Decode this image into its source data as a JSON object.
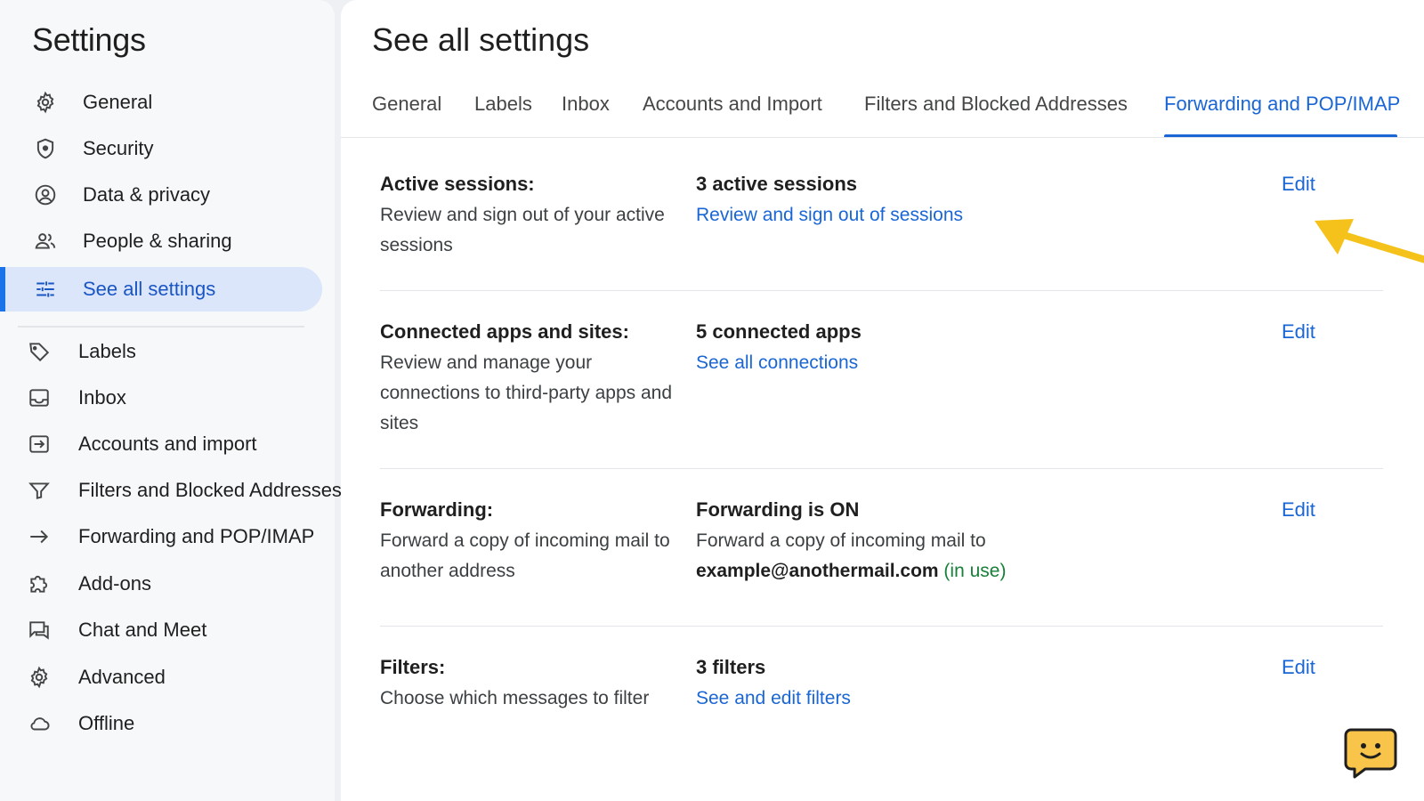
{
  "sidebar": {
    "title": "Settings",
    "items_top": [
      {
        "label": "General",
        "icon": "gear-icon"
      },
      {
        "label": "Security",
        "icon": "shield-icon"
      },
      {
        "label": "Data & privacy",
        "icon": "account-circle-icon"
      },
      {
        "label": "People & sharing",
        "icon": "people-icon"
      },
      {
        "label": "See all settings",
        "icon": "tune-icon",
        "active": true
      }
    ],
    "items_bottom": [
      {
        "label": "Labels",
        "icon": "label-icon"
      },
      {
        "label": "Inbox",
        "icon": "inbox-icon"
      },
      {
        "label": "Accounts and import",
        "icon": "import-icon"
      },
      {
        "label": "Filters and Blocked Addresses",
        "icon": "filter-icon"
      },
      {
        "label": "Forwarding and POP/IMAP",
        "icon": "arrow-right-icon"
      },
      {
        "label": "Add-ons",
        "icon": "puzzle-icon"
      },
      {
        "label": "Chat and Meet",
        "icon": "chat-icon"
      },
      {
        "label": "Advanced",
        "icon": "gear-icon"
      },
      {
        "label": "Offline",
        "icon": "cloud-icon"
      }
    ]
  },
  "main": {
    "title": "See all settings",
    "tabs": [
      {
        "label": "General"
      },
      {
        "label": "Labels"
      },
      {
        "label": "Inbox"
      },
      {
        "label": "Accounts and Import"
      },
      {
        "label": "Filters and Blocked Addresses"
      },
      {
        "label": "Forwarding and POP/IMAP",
        "active": true
      }
    ],
    "rows": [
      {
        "label": "Active sessions:",
        "description": "Review and sign out of your active sessions",
        "status": "3 active sessions",
        "link": "Review and sign out of sessions",
        "edit": "Edit"
      },
      {
        "label": "Connected apps and sites:",
        "description": "Review and manage your connections to third-party apps and sites",
        "status": "5 connected apps",
        "link": "See all connections",
        "edit": "Edit"
      },
      {
        "label": "Forwarding:",
        "description": "Forward a copy of incoming mail to another address",
        "status": "Forwarding is ON",
        "text": "Forward a copy of incoming mail to",
        "email": "example@anothermail.com",
        "email_note": " (in use)",
        "edit": "Edit"
      },
      {
        "label": "Filters:",
        "description": "Choose which messages to filter",
        "status": "3 filters",
        "link": "See and edit filters",
        "edit": "Edit"
      }
    ]
  },
  "colors": {
    "accent": "#1a66d4",
    "active_nav_bg": "#dbe6fb",
    "in_use": "#188038",
    "annotation_arrow": "#f5c21b",
    "help_bubble": "#f8c54a"
  }
}
